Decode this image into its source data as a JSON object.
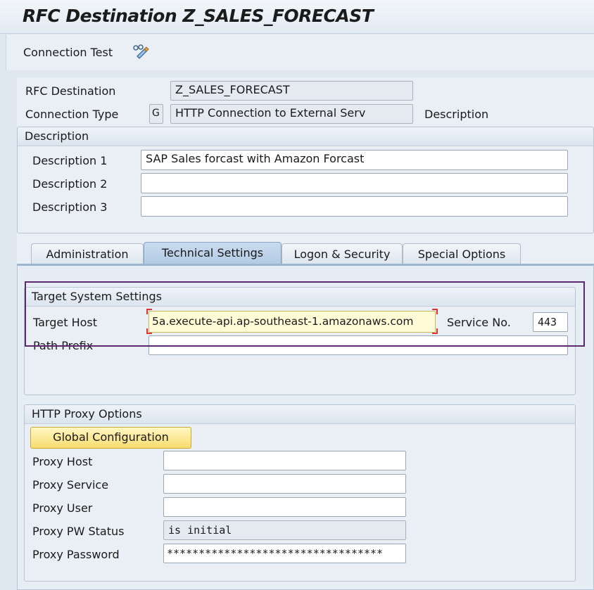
{
  "window": {
    "title": "RFC Destination Z_SALES_FORECAST"
  },
  "toolbar": {
    "connection_test_label": "Connection Test",
    "connection_test_icon": "connection-test-icon"
  },
  "header": {
    "rfc_destination_label": "RFC Destination",
    "rfc_destination_value": "Z_SALES_FORECAST",
    "connection_type_label": "Connection Type",
    "connection_type_code": "G",
    "connection_type_value": "HTTP Connection to External Serv",
    "description_label": "Description"
  },
  "description_group": {
    "title": "Description",
    "rows": [
      {
        "label": "Description 1",
        "value": "SAP Sales forcast with Amazon Forcast"
      },
      {
        "label": "Description 2",
        "value": ""
      },
      {
        "label": "Description 3",
        "value": ""
      }
    ]
  },
  "tabs": [
    {
      "label": "Administration",
      "active": false
    },
    {
      "label": "Technical Settings",
      "active": true
    },
    {
      "label": "Logon & Security",
      "active": false
    },
    {
      "label": "Special Options",
      "active": false
    }
  ],
  "target_system": {
    "title": "Target System Settings",
    "target_host_label": "Target Host",
    "target_host_value": "5a.execute-api.ap-southeast-1.amazonaws.com",
    "service_no_label": "Service No.",
    "service_no_value": "443",
    "path_prefix_label": "Path Prefix",
    "path_prefix_value": ""
  },
  "proxy": {
    "title": "HTTP Proxy Options",
    "global_config_label": "Global Configuration",
    "rows": [
      {
        "label": "Proxy Host",
        "value": ""
      },
      {
        "label": "Proxy Service",
        "value": ""
      },
      {
        "label": "Proxy User",
        "value": ""
      },
      {
        "label": "Proxy PW Status",
        "value": "is initial"
      },
      {
        "label": "Proxy Password",
        "value": "**********************************"
      }
    ]
  },
  "colors": {
    "highlight_border": "#5b2a6e",
    "focus_corner": "#e0342c",
    "button_yellow": "#f7dc6e"
  }
}
